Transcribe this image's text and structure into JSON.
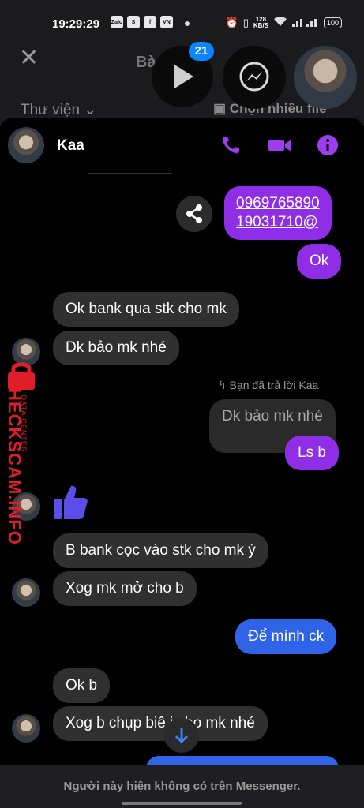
{
  "status_bar": {
    "time": "19:29:29",
    "notif_icons": [
      "Zalo",
      "S",
      "f",
      "VN"
    ],
    "speed_top": "128",
    "speed_bottom": "KB/S",
    "battery": "100"
  },
  "background_app": {
    "title": "Bà   ới",
    "library_label": "Thư viện",
    "multi_select_label": "Chọn nhiều file",
    "badge_count": "21"
  },
  "chat": {
    "name": "Kaa",
    "accent_color": "#8f2ee6"
  },
  "messages": {
    "m1_line1": "0969765890",
    "m1_line2": "19031710@",
    "m2": "Ok",
    "m3": "Ok bank qua stk cho mk",
    "m4": "Dk bảo mk nhé",
    "reply_note": "Bạn đã trả lời Kaa",
    "m5_quoted": "Dk bảo mk nhé",
    "m6": "Ls b",
    "m7": "B bank cọc vào stk cho mk ý",
    "m8": "Xog mk mở cho b",
    "m9": "Để mình ck",
    "m10": "Ok b",
    "m11": "Xog b chụp biê   i cho mk nhé"
  },
  "watermark": {
    "main": "CHECKSCAM.INFO",
    "sub": "DATA CENTER"
  },
  "footer": {
    "notice": "Người này hiện không có trên Messenger."
  }
}
